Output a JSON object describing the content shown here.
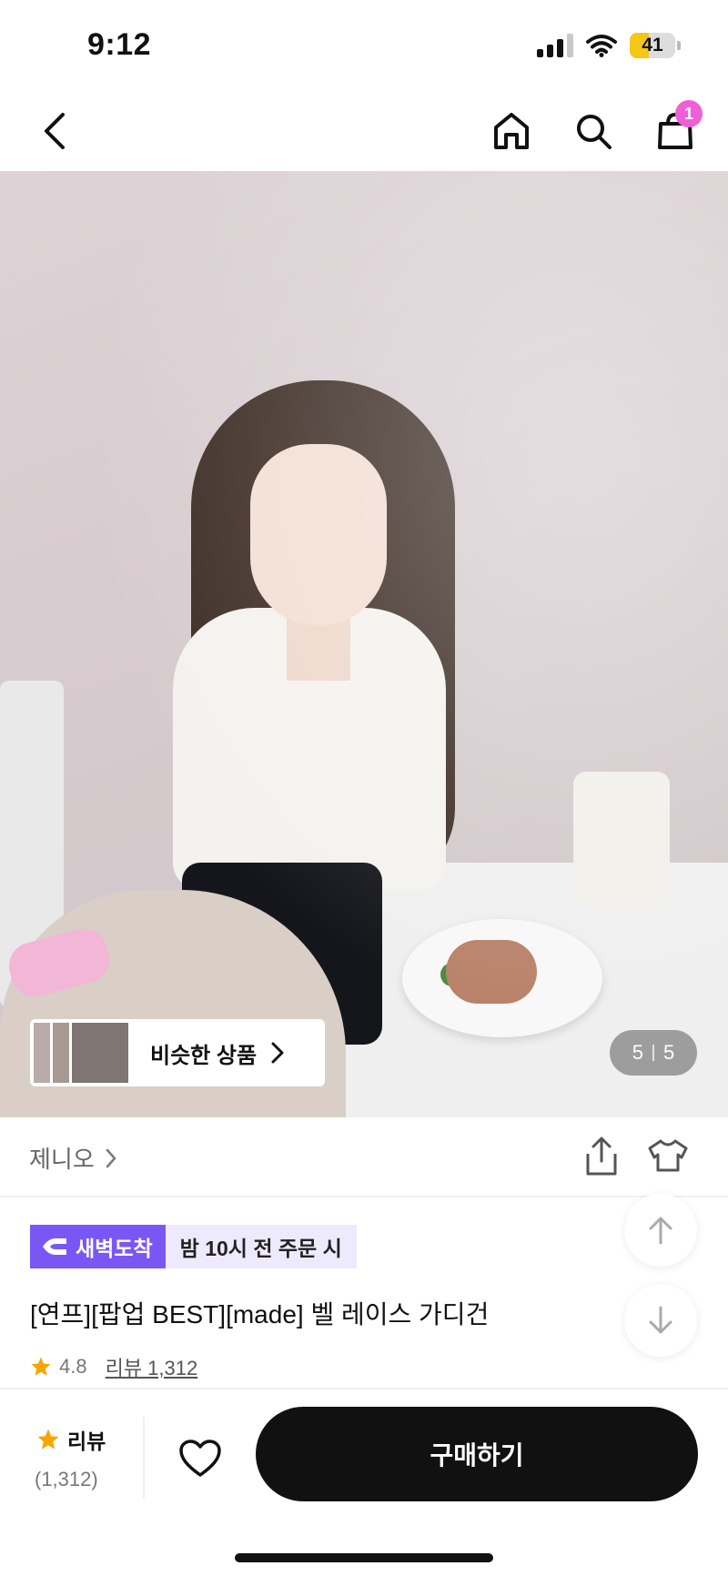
{
  "status_bar": {
    "time": "9:12",
    "battery": "41"
  },
  "nav": {
    "cart_badge": "1"
  },
  "gallery": {
    "similar_label": "비슷한 상품",
    "counter_current": "5",
    "counter_total": "5"
  },
  "brand": {
    "name": "제니오"
  },
  "product": {
    "delivery_badge": "새벽도착",
    "delivery_note": "밤 10시 전 주문 시",
    "title": "[연프][팝업 BEST][made] 벨 레이스 가디건",
    "rating": "4.8",
    "review_link": "리뷰 1,312"
  },
  "bottom_bar": {
    "review_label": "리뷰",
    "review_count": "(1,312)",
    "buy_label": "구매하기"
  },
  "colors": {
    "accent_purple": "#7a57f5",
    "badge_pink": "#f05fd8",
    "star": "#f7a600",
    "buy_button": "#111111"
  },
  "icons": [
    "back-icon",
    "home-icon",
    "search-icon",
    "cart-icon",
    "chevron-right-icon",
    "share-icon",
    "hanger-icon",
    "arrow-up-icon",
    "arrow-down-icon",
    "star-icon",
    "heart-icon",
    "dawn-delivery-icon"
  ]
}
